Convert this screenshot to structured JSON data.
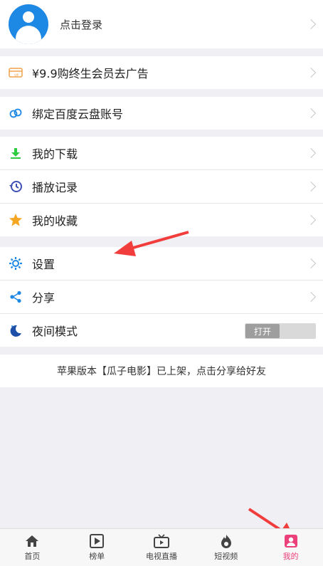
{
  "profile": {
    "login_label": "点击登录"
  },
  "menu_groups": [
    {
      "items": [
        {
          "label": "¥9.9购终生会员去广告",
          "icon": "vip-card-icon"
        }
      ]
    },
    {
      "items": [
        {
          "label": "绑定百度云盘账号",
          "icon": "baidu-cloud-icon"
        }
      ]
    },
    {
      "items": [
        {
          "label": "我的下载",
          "icon": "download-icon"
        },
        {
          "label": "播放记录",
          "icon": "history-icon"
        },
        {
          "label": "我的收藏",
          "icon": "star-icon"
        }
      ]
    },
    {
      "items": [
        {
          "label": "设置",
          "icon": "gear-icon"
        },
        {
          "label": "分享",
          "icon": "share-icon"
        },
        {
          "label": "夜间模式",
          "icon": "moon-icon",
          "toggle_label": "打开"
        }
      ]
    }
  ],
  "notice": "苹果版本【瓜子电影】已上架，点击分享给好友",
  "tabs": [
    {
      "label": "首页",
      "icon": "home-icon"
    },
    {
      "label": "榜单",
      "icon": "ranking-icon"
    },
    {
      "label": "电视直播",
      "icon": "tv-icon"
    },
    {
      "label": "短视频",
      "icon": "flame-icon"
    },
    {
      "label": "我的",
      "icon": "user-icon",
      "active": true
    }
  ],
  "colors": {
    "accent": "#ec407a",
    "avatar": "#1e88e5",
    "arrow": "#f23d3d"
  }
}
